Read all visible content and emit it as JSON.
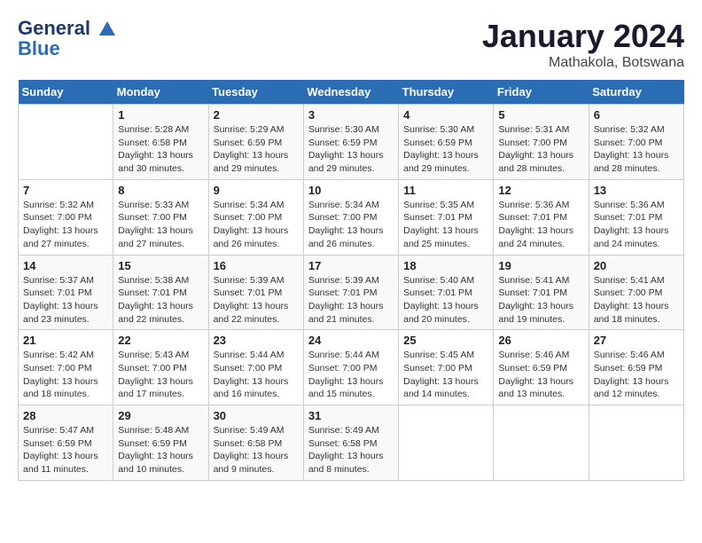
{
  "header": {
    "logo_line1": "General",
    "logo_line2": "Blue",
    "month": "January 2024",
    "location": "Mathakola, Botswana"
  },
  "weekdays": [
    "Sunday",
    "Monday",
    "Tuesday",
    "Wednesday",
    "Thursday",
    "Friday",
    "Saturday"
  ],
  "weeks": [
    [
      {
        "day": "",
        "sunrise": "",
        "sunset": "",
        "daylight": ""
      },
      {
        "day": "1",
        "sunrise": "Sunrise: 5:28 AM",
        "sunset": "Sunset: 6:58 PM",
        "daylight": "Daylight: 13 hours and 30 minutes."
      },
      {
        "day": "2",
        "sunrise": "Sunrise: 5:29 AM",
        "sunset": "Sunset: 6:59 PM",
        "daylight": "Daylight: 13 hours and 29 minutes."
      },
      {
        "day": "3",
        "sunrise": "Sunrise: 5:30 AM",
        "sunset": "Sunset: 6:59 PM",
        "daylight": "Daylight: 13 hours and 29 minutes."
      },
      {
        "day": "4",
        "sunrise": "Sunrise: 5:30 AM",
        "sunset": "Sunset: 6:59 PM",
        "daylight": "Daylight: 13 hours and 29 minutes."
      },
      {
        "day": "5",
        "sunrise": "Sunrise: 5:31 AM",
        "sunset": "Sunset: 7:00 PM",
        "daylight": "Daylight: 13 hours and 28 minutes."
      },
      {
        "day": "6",
        "sunrise": "Sunrise: 5:32 AM",
        "sunset": "Sunset: 7:00 PM",
        "daylight": "Daylight: 13 hours and 28 minutes."
      }
    ],
    [
      {
        "day": "7",
        "sunrise": "Sunrise: 5:32 AM",
        "sunset": "Sunset: 7:00 PM",
        "daylight": "Daylight: 13 hours and 27 minutes."
      },
      {
        "day": "8",
        "sunrise": "Sunrise: 5:33 AM",
        "sunset": "Sunset: 7:00 PM",
        "daylight": "Daylight: 13 hours and 27 minutes."
      },
      {
        "day": "9",
        "sunrise": "Sunrise: 5:34 AM",
        "sunset": "Sunset: 7:00 PM",
        "daylight": "Daylight: 13 hours and 26 minutes."
      },
      {
        "day": "10",
        "sunrise": "Sunrise: 5:34 AM",
        "sunset": "Sunset: 7:00 PM",
        "daylight": "Daylight: 13 hours and 26 minutes."
      },
      {
        "day": "11",
        "sunrise": "Sunrise: 5:35 AM",
        "sunset": "Sunset: 7:01 PM",
        "daylight": "Daylight: 13 hours and 25 minutes."
      },
      {
        "day": "12",
        "sunrise": "Sunrise: 5:36 AM",
        "sunset": "Sunset: 7:01 PM",
        "daylight": "Daylight: 13 hours and 24 minutes."
      },
      {
        "day": "13",
        "sunrise": "Sunrise: 5:36 AM",
        "sunset": "Sunset: 7:01 PM",
        "daylight": "Daylight: 13 hours and 24 minutes."
      }
    ],
    [
      {
        "day": "14",
        "sunrise": "Sunrise: 5:37 AM",
        "sunset": "Sunset: 7:01 PM",
        "daylight": "Daylight: 13 hours and 23 minutes."
      },
      {
        "day": "15",
        "sunrise": "Sunrise: 5:38 AM",
        "sunset": "Sunset: 7:01 PM",
        "daylight": "Daylight: 13 hours and 22 minutes."
      },
      {
        "day": "16",
        "sunrise": "Sunrise: 5:39 AM",
        "sunset": "Sunset: 7:01 PM",
        "daylight": "Daylight: 13 hours and 22 minutes."
      },
      {
        "day": "17",
        "sunrise": "Sunrise: 5:39 AM",
        "sunset": "Sunset: 7:01 PM",
        "daylight": "Daylight: 13 hours and 21 minutes."
      },
      {
        "day": "18",
        "sunrise": "Sunrise: 5:40 AM",
        "sunset": "Sunset: 7:01 PM",
        "daylight": "Daylight: 13 hours and 20 minutes."
      },
      {
        "day": "19",
        "sunrise": "Sunrise: 5:41 AM",
        "sunset": "Sunset: 7:01 PM",
        "daylight": "Daylight: 13 hours and 19 minutes."
      },
      {
        "day": "20",
        "sunrise": "Sunrise: 5:41 AM",
        "sunset": "Sunset: 7:00 PM",
        "daylight": "Daylight: 13 hours and 18 minutes."
      }
    ],
    [
      {
        "day": "21",
        "sunrise": "Sunrise: 5:42 AM",
        "sunset": "Sunset: 7:00 PM",
        "daylight": "Daylight: 13 hours and 18 minutes."
      },
      {
        "day": "22",
        "sunrise": "Sunrise: 5:43 AM",
        "sunset": "Sunset: 7:00 PM",
        "daylight": "Daylight: 13 hours and 17 minutes."
      },
      {
        "day": "23",
        "sunrise": "Sunrise: 5:44 AM",
        "sunset": "Sunset: 7:00 PM",
        "daylight": "Daylight: 13 hours and 16 minutes."
      },
      {
        "day": "24",
        "sunrise": "Sunrise: 5:44 AM",
        "sunset": "Sunset: 7:00 PM",
        "daylight": "Daylight: 13 hours and 15 minutes."
      },
      {
        "day": "25",
        "sunrise": "Sunrise: 5:45 AM",
        "sunset": "Sunset: 7:00 PM",
        "daylight": "Daylight: 13 hours and 14 minutes."
      },
      {
        "day": "26",
        "sunrise": "Sunrise: 5:46 AM",
        "sunset": "Sunset: 6:59 PM",
        "daylight": "Daylight: 13 hours and 13 minutes."
      },
      {
        "day": "27",
        "sunrise": "Sunrise: 5:46 AM",
        "sunset": "Sunset: 6:59 PM",
        "daylight": "Daylight: 13 hours and 12 minutes."
      }
    ],
    [
      {
        "day": "28",
        "sunrise": "Sunrise: 5:47 AM",
        "sunset": "Sunset: 6:59 PM",
        "daylight": "Daylight: 13 hours and 11 minutes."
      },
      {
        "day": "29",
        "sunrise": "Sunrise: 5:48 AM",
        "sunset": "Sunset: 6:59 PM",
        "daylight": "Daylight: 13 hours and 10 minutes."
      },
      {
        "day": "30",
        "sunrise": "Sunrise: 5:49 AM",
        "sunset": "Sunset: 6:58 PM",
        "daylight": "Daylight: 13 hours and 9 minutes."
      },
      {
        "day": "31",
        "sunrise": "Sunrise: 5:49 AM",
        "sunset": "Sunset: 6:58 PM",
        "daylight": "Daylight: 13 hours and 8 minutes."
      },
      {
        "day": "",
        "sunrise": "",
        "sunset": "",
        "daylight": ""
      },
      {
        "day": "",
        "sunrise": "",
        "sunset": "",
        "daylight": ""
      },
      {
        "day": "",
        "sunrise": "",
        "sunset": "",
        "daylight": ""
      }
    ]
  ]
}
